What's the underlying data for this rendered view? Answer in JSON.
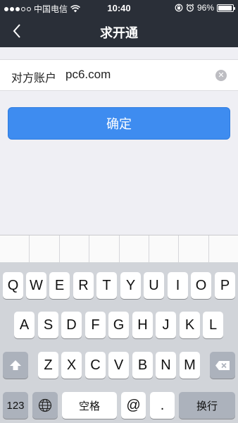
{
  "status_bar": {
    "carrier": "中国电信",
    "time": "10:40",
    "battery": "96%"
  },
  "nav": {
    "title": "求开通"
  },
  "account_field": {
    "label": "对方账户",
    "value": "pc6.com"
  },
  "confirm_label": "确定",
  "keyboard": {
    "row1": [
      "Q",
      "W",
      "E",
      "R",
      "T",
      "Y",
      "U",
      "I",
      "O",
      "P"
    ],
    "row2": [
      "A",
      "S",
      "D",
      "F",
      "G",
      "H",
      "J",
      "K",
      "L"
    ],
    "row3": [
      "Z",
      "X",
      "C",
      "V",
      "B",
      "N",
      "M"
    ],
    "numbers_label": "123",
    "space_label": "空格",
    "at_label": "@",
    "dot_label": ".",
    "return_label": "换行"
  }
}
